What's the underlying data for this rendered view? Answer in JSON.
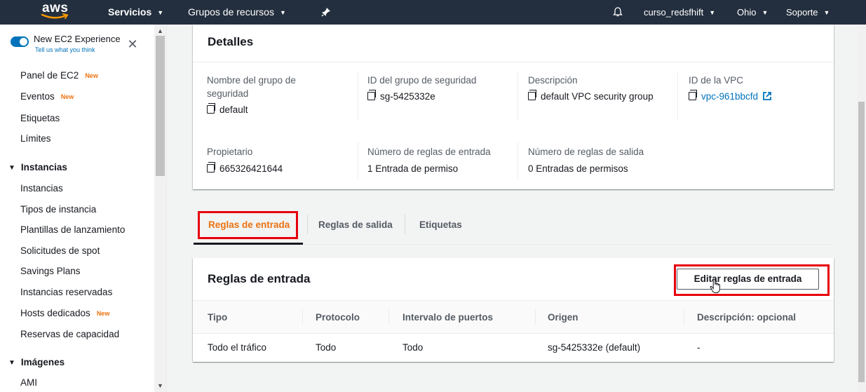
{
  "colors": {
    "nav_bg": "#232f3e",
    "accent_orange": "#ec7211",
    "link_blue": "#0073bb",
    "highlight_red": "#e7000b"
  },
  "topnav": {
    "logo": "aws",
    "services": "Servicios",
    "resource_groups": "Grupos de recursos",
    "pin_icon": "pin-icon",
    "bell_icon": "bell-icon",
    "user": "curso_redsfhift",
    "region": "Ohio",
    "support": "Soporte"
  },
  "sidebar": {
    "experience_title": "New EC2 Experience",
    "experience_sub": "Tell us what you think",
    "new_badge": "New",
    "items": [
      {
        "label": "Panel de EC2",
        "new": true
      },
      {
        "label": "Eventos",
        "new": true
      },
      {
        "label": "Etiquetas",
        "new": false
      },
      {
        "label": "Límites",
        "new": false
      }
    ],
    "section_instances": "Instancias",
    "instances_items": [
      {
        "label": "Instancias",
        "new": false
      },
      {
        "label": "Tipos de instancia",
        "new": false
      },
      {
        "label": "Plantillas de lanzamiento",
        "new": false
      },
      {
        "label": "Solicitudes de spot",
        "new": false
      },
      {
        "label": "Savings Plans",
        "new": false
      },
      {
        "label": "Instancias reservadas",
        "new": false
      },
      {
        "label": "Hosts dedicados",
        "new": true
      },
      {
        "label": "Reservas de capacidad",
        "new": false
      }
    ],
    "section_images": "Imágenes",
    "images_items": [
      {
        "label": "AMI"
      }
    ]
  },
  "details": {
    "title": "Detalles",
    "fields": {
      "group_name_label": "Nombre del grupo de seguridad",
      "group_name_value": "default",
      "group_id_label": "ID del grupo de seguridad",
      "group_id_value": "sg-5425332e",
      "description_label": "Descripción",
      "description_value": "default VPC security group",
      "vpc_label": "ID de la VPC",
      "vpc_value": "vpc-961bbcfd",
      "owner_label": "Propietario",
      "owner_value": "665326421644",
      "inbound_count_label": "Número de reglas de entrada",
      "inbound_count_value": "1 Entrada de permiso",
      "outbound_count_label": "Número de reglas de salida",
      "outbound_count_value": "0 Entradas de permisos"
    }
  },
  "tabs": {
    "inbound": "Reglas de entrada",
    "outbound": "Reglas de salida",
    "tags": "Etiquetas",
    "active": "inbound"
  },
  "inbound_rules": {
    "title": "Reglas de entrada",
    "edit_button": "Editar reglas de entrada",
    "columns": [
      "Tipo",
      "Protocolo",
      "Intervalo de puertos",
      "Origen",
      "Descripción: opcional"
    ],
    "rows": [
      [
        "Todo el tráfico",
        "Todo",
        "Todo",
        "sg-5425332e (default)",
        "-"
      ]
    ]
  }
}
